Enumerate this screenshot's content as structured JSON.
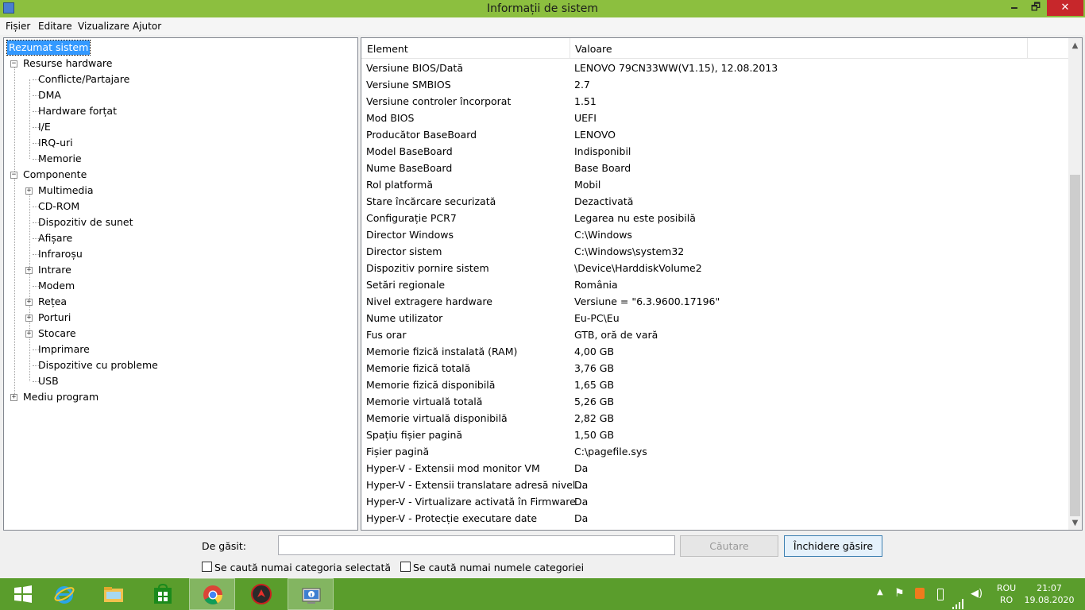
{
  "window": {
    "title": "Informații de sistem"
  },
  "controls": {
    "minimize": "🗕",
    "maximize": "🗗",
    "close": "✕"
  },
  "menu": [
    "Fișier",
    "Editare",
    "Vizualizare",
    "Ajutor"
  ],
  "tree": [
    {
      "label": "Rezumat sistem"
    },
    {
      "label": "Resurse hardware"
    },
    {
      "label": "Conflicte/Partajare"
    },
    {
      "label": "DMA"
    },
    {
      "label": "Hardware forțat"
    },
    {
      "label": "I/E"
    },
    {
      "label": "IRQ-uri"
    },
    {
      "label": "Memorie"
    },
    {
      "label": "Componente"
    },
    {
      "label": "Multimedia"
    },
    {
      "label": "CD-ROM"
    },
    {
      "label": "Dispozitiv de sunet"
    },
    {
      "label": "Afișare"
    },
    {
      "label": "Infraroșu"
    },
    {
      "label": "Intrare"
    },
    {
      "label": "Modem"
    },
    {
      "label": "Rețea"
    },
    {
      "label": "Porturi"
    },
    {
      "label": "Stocare"
    },
    {
      "label": "Imprimare"
    },
    {
      "label": "Dispozitive cu probleme"
    },
    {
      "label": "USB"
    },
    {
      "label": "Mediu program"
    }
  ],
  "table": {
    "columns": [
      "Element",
      "Valoare"
    ],
    "rows": [
      [
        "Versiune BIOS/Dată",
        "LENOVO 79CN33WW(V1.15), 12.08.2013"
      ],
      [
        "Versiune SMBIOS",
        "2.7"
      ],
      [
        "Versiune controler încorporat",
        "1.51"
      ],
      [
        "Mod BIOS",
        "UEFI"
      ],
      [
        "Producător BaseBoard",
        "LENOVO"
      ],
      [
        "Model BaseBoard",
        "Indisponibil"
      ],
      [
        "Nume BaseBoard",
        "Base Board"
      ],
      [
        "Rol platformă",
        "Mobil"
      ],
      [
        "Stare încărcare securizată",
        "Dezactivată"
      ],
      [
        "Configurație PCR7",
        "Legarea nu este posibilă"
      ],
      [
        "Director Windows",
        "C:\\Windows"
      ],
      [
        "Director sistem",
        "C:\\Windows\\system32"
      ],
      [
        "Dispozitiv pornire sistem",
        "\\Device\\HarddiskVolume2"
      ],
      [
        "Setări regionale",
        "România"
      ],
      [
        "Nivel extragere hardware",
        "Versiune = \"6.3.9600.17196\""
      ],
      [
        "Nume utilizator",
        "Eu-PC\\Eu"
      ],
      [
        "Fus orar",
        "GTB, oră de vară"
      ],
      [
        "Memorie fizică instalată (RAM)",
        "4,00 GB"
      ],
      [
        "Memorie fizică totală",
        "3,76 GB"
      ],
      [
        "Memorie fizică disponibilă",
        "1,65 GB"
      ],
      [
        "Memorie virtuală totală",
        "5,26 GB"
      ],
      [
        "Memorie virtuală disponibilă",
        "2,82 GB"
      ],
      [
        "Spațiu fișier pagină",
        "1,50 GB"
      ],
      [
        "Fișier pagină",
        "C:\\pagefile.sys"
      ],
      [
        "Hyper-V - Extensii mod monitor VM",
        "Da"
      ],
      [
        "Hyper-V - Extensii translatare adresă nivel...",
        "Da"
      ],
      [
        "Hyper-V - Virtualizare activată în Firmware",
        "Da"
      ],
      [
        "Hyper-V - Protecție executare date",
        "Da"
      ]
    ]
  },
  "find": {
    "label": "De găsit:",
    "value": "",
    "search_button": "Căutare",
    "close_button": "Închidere găsire",
    "check_selected_category": "Se caută numai categoria selectată",
    "check_category_names": "Se caută numai numele categoriei"
  },
  "taskbar": {
    "language": "ROU",
    "region": "RO",
    "time": "21:07",
    "date": "19.08.2020"
  },
  "colors": {
    "titlebar": "#8cbf3f",
    "taskbar": "#5a9d2c",
    "selection": "#3399ff",
    "close": "#c7272b"
  }
}
